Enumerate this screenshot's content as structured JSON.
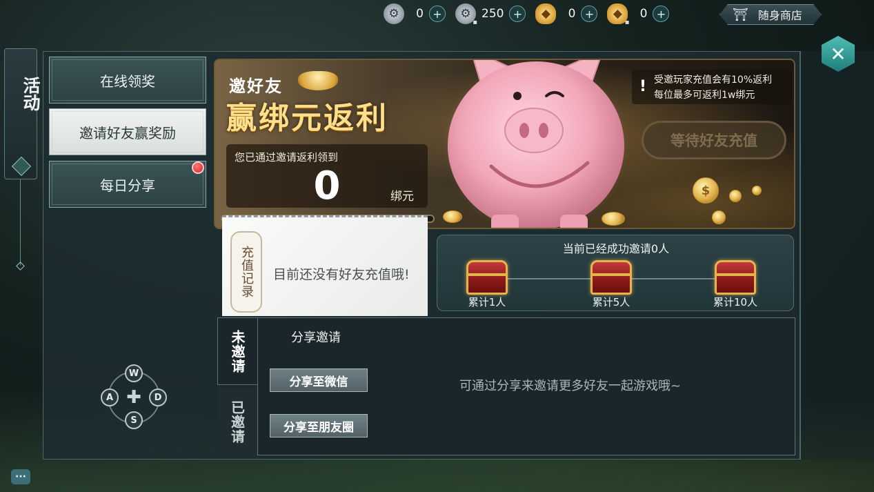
{
  "currencies": [
    {
      "icon": "wheel-coin-icon",
      "value": "0",
      "locked": false
    },
    {
      "icon": "locked-wheel-coin-icon",
      "value": "250",
      "locked": true
    },
    {
      "icon": "gold-ingot-icon",
      "value": "0",
      "locked": false
    },
    {
      "icon": "locked-gold-ingot-icon",
      "value": "0",
      "locked": true
    }
  ],
  "shop": {
    "label": "随身商店",
    "icon": "shop-icon"
  },
  "side_tab": {
    "label": "活动"
  },
  "menu": {
    "items": [
      {
        "label": "在线领奖",
        "active": false,
        "badge": false
      },
      {
        "label": "邀请好友赢奖励",
        "active": true,
        "badge": false
      },
      {
        "label": "每日分享",
        "active": false,
        "badge": true
      }
    ]
  },
  "banner": {
    "subtitle": "邀好友",
    "title": "赢绑元返利",
    "earned_label": "您已通过邀请返利领到",
    "earned_value": "0",
    "earned_unit": "绑元",
    "notice_line1": "受邀玩家充值会有10%返利",
    "notice_line2": "每位最多可返利1w绑元",
    "wait_button": "等待好友充值"
  },
  "record": {
    "tag": "充值记录",
    "empty_text": "目前还没有好友充值哦!"
  },
  "progress": {
    "title": "当前已经成功邀请0人",
    "milestones": [
      "累计1人",
      "累计5人",
      "累计10人"
    ]
  },
  "invite_tabs": {
    "not_invited": "未邀请",
    "invited": "已邀请"
  },
  "invite_section": {
    "title": "分享邀请",
    "share_wechat": "分享至微信",
    "share_moments": "分享至朋友圈",
    "empty_hint": "可通过分享来邀请更多好友一起游戏哦~"
  },
  "dpad": {
    "up": "W",
    "left": "A",
    "right": "D",
    "down": "S"
  },
  "chat": {
    "label": "···"
  },
  "colors": {
    "accent": "#4fbdb3",
    "gold": "#ffdf8a",
    "panel": "#1e2c30",
    "badge": "#d61e1e"
  }
}
